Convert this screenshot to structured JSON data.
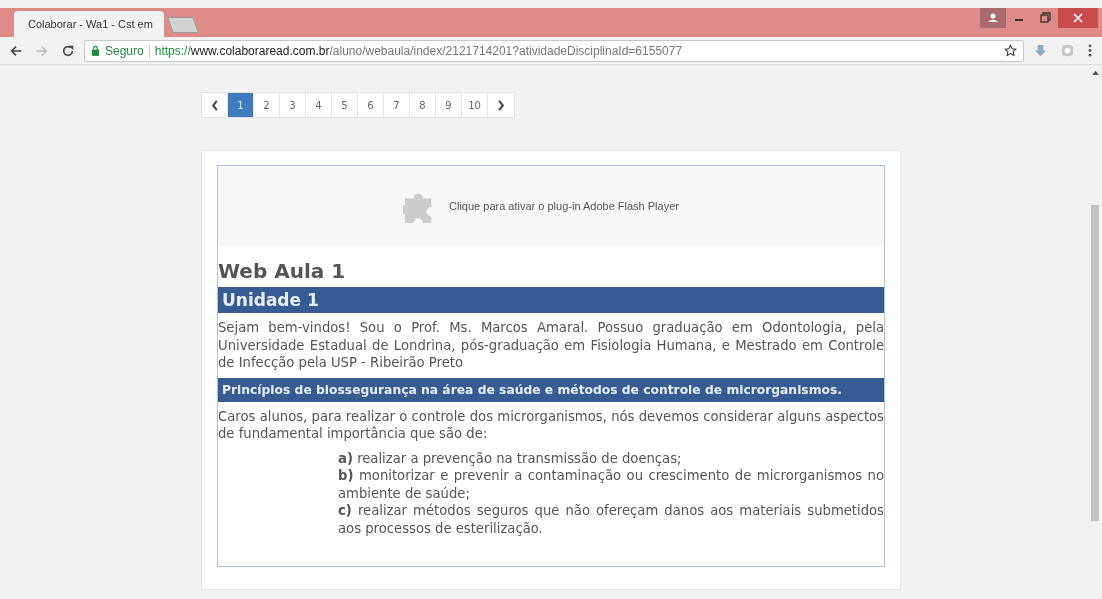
{
  "browser": {
    "tab_title": "Colaborar - Wa1 - Cst em",
    "security_label": "Seguro",
    "url": {
      "scheme": "https://",
      "host": "www.colaboraread.com.br",
      "path": "/aluno/webaula/index/2121714201?atividadeDisciplinaId=6155077"
    }
  },
  "pagination": {
    "pages": [
      {
        "label": "1",
        "selected": true
      },
      {
        "label": "2",
        "selected": false
      },
      {
        "label": "3",
        "selected": false
      },
      {
        "label": "4",
        "selected": false
      },
      {
        "label": "5",
        "selected": false
      },
      {
        "label": "6",
        "selected": false
      },
      {
        "label": "7",
        "selected": false
      },
      {
        "label": "8",
        "selected": false
      },
      {
        "label": "9",
        "selected": false
      },
      {
        "label": "10",
        "selected": false
      }
    ]
  },
  "plugin": {
    "message": "Clique para ativar o plug-in Adobe Flash Player"
  },
  "lesson": {
    "title": "Web Aula 1",
    "unit": "Unidade 1",
    "intro": "Sejam bem-vindos! Sou o Prof. Ms. Marcos Amaral. Possuo graduação em Odontologia, pela Universidade Estadual de Londrina, pós-graduação em Fisiologia Humana, e Mestrado em Controle de Infecção pela USP - Ribeirão Preto",
    "section": "Princípios de biossegurança na área de saúde e métodos de controle de microrganismos.",
    "paragraph": "Caros alunos, para realizar o controle dos microrganismos, nós devemos considerar alguns aspectos de fundamental importância que são de:",
    "items": [
      "**a)** realizar a prevenção na transmissão de doenças;",
      "**b)** monitorizar e prevenir a contaminação ou crescimento de microrganismos no ambiente de saúde;",
      "**c)** realizar métodos seguros que não ofereçam danos aos materiais submetidos aos processos de esterilização."
    ]
  }
}
